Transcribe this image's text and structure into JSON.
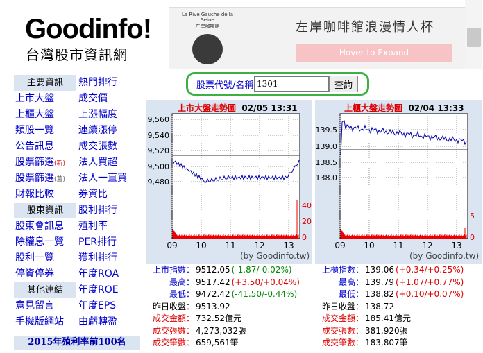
{
  "site": {
    "title": "Goodinfo!",
    "subtitle": "台灣股市資訊網"
  },
  "banner": {
    "brand_line1": "La Rive Gauche de la Seine",
    "brand_line2": "左岸咖啡館",
    "title": "左岸咖啡館浪漫情人杯",
    "button": "Hover to Expand"
  },
  "menu": {
    "sections": [
      {
        "headers": [
          "主要資訊",
          "熱門排行"
        ],
        "rows": [
          [
            "上市大盤",
            "成交價"
          ],
          [
            "上櫃大盤",
            "上漲幅度"
          ],
          [
            "類股一覽",
            "連續漲停"
          ],
          [
            "公告訊息",
            "成交張數"
          ],
          [
            "股票篩選",
            "法人買超"
          ],
          [
            "股票篩選",
            "法人一直買"
          ],
          [
            "財報比較",
            "券資比"
          ]
        ]
      },
      {
        "headers": [
          "股東資訊",
          "股利排行"
        ],
        "rows": [
          [
            "股東會訊息",
            "殖利率"
          ],
          [
            "除權息一覽",
            "PER排行"
          ],
          [
            "股利一覽",
            "獲利排行"
          ],
          [
            "停資停券",
            "年度ROA"
          ]
        ]
      },
      {
        "headers": [
          "其他連結",
          "年度ROE"
        ],
        "rows": [
          [
            "意見留言",
            "年度EPS"
          ],
          [
            "手機版網站",
            "由虧轉盈"
          ]
        ]
      }
    ],
    "tags": {
      "new": "(新)",
      "old": "(舊)"
    },
    "footer": "2015年殖利率前100名"
  },
  "search": {
    "label": "股票代號/名稱",
    "value": "1301",
    "button": "查詢"
  },
  "credit": "(by Goodinfo.tw)",
  "tse": {
    "title": "上市大盤走勢圖",
    "time": "02/05 13:31",
    "stats": [
      {
        "label": "上市指數：",
        "value": "9512.05",
        "change": "(-1.87/-0.02%)",
        "dir": "down"
      },
      {
        "label": "最高：",
        "value": "9517.42",
        "change": "(+3.50/+0.04%)",
        "dir": "up"
      },
      {
        "label": "最低：",
        "value": "9472.42",
        "change": "(-41.50/-0.44%)",
        "dir": "down"
      },
      {
        "label": "昨日收盤：",
        "value": "9513.92",
        "change": "",
        "dir": "none"
      },
      {
        "label": "成交金額：",
        "value": "732.52億元",
        "change": "",
        "dir": "none"
      },
      {
        "label": "成交張數：",
        "value": "4,273,032張",
        "change": "",
        "dir": "none"
      },
      {
        "label": "成交筆數：",
        "value": "659,561筆",
        "change": "",
        "dir": "none"
      }
    ],
    "y_ticks": [
      "9,560",
      "9,540",
      "9,520",
      "9,500",
      "9,480"
    ],
    "vol_ticks": [
      "40",
      "20",
      "0"
    ],
    "x_ticks": [
      "09",
      "10",
      "11",
      "12",
      "13"
    ]
  },
  "otc": {
    "title": "上櫃大盤走勢圖",
    "time": "02/04 13:33",
    "stats": [
      {
        "label": "上櫃指數：",
        "value": "139.06",
        "change": "(+0.34/+0.25%)",
        "dir": "up"
      },
      {
        "label": "最高：",
        "value": "139.79",
        "change": "(+1.07/+0.77%)",
        "dir": "up"
      },
      {
        "label": "最低：",
        "value": "138.82",
        "change": "(+0.10/+0.07%)",
        "dir": "up"
      },
      {
        "label": "昨日收盤：",
        "value": "138.72",
        "change": "",
        "dir": "none"
      },
      {
        "label": "成交金額：",
        "value": "185.41億元",
        "change": "",
        "dir": "none"
      },
      {
        "label": "成交張數：",
        "value": "381,920張",
        "change": "",
        "dir": "none"
      },
      {
        "label": "成交筆數：",
        "value": "183,807筆",
        "change": "",
        "dir": "none"
      }
    ],
    "y_ticks": [
      "139.5",
      "139.0",
      "138.5",
      "138.0"
    ],
    "vol_ticks": [
      "5",
      "0"
    ],
    "x_ticks": [
      "09",
      "10",
      "11",
      "12",
      "13"
    ]
  }
}
